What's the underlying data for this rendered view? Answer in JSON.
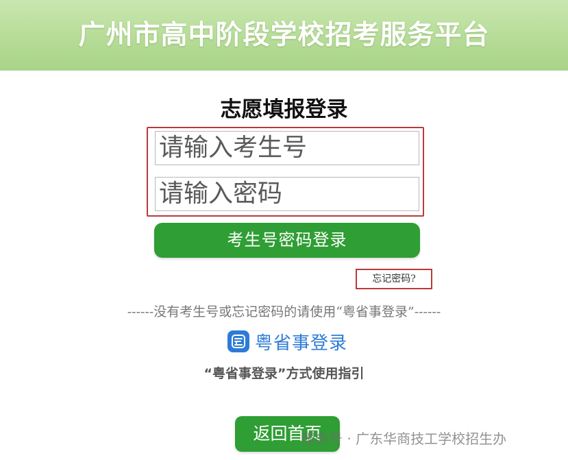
{
  "header": {
    "title": "广州市高中阶段学校招考服务平台"
  },
  "login": {
    "title": "志愿填报登录",
    "candidate_placeholder": "请输入考生号",
    "password_placeholder": "请输入密码",
    "submit_label": "考生号密码登录",
    "forgot_label": "忘记密码?"
  },
  "alternative": {
    "hint": "------没有考生号或忘记密码的请使用“粤省事登录”------",
    "yss_label": "粤省事登录",
    "guide_label": "“粤省事登录”方式使用指引"
  },
  "footer": {
    "back_label": "返回首页",
    "watermark": "服务号 · 广东华商技工学校招生办"
  },
  "icons": {
    "yss_logo": "yss-logo-icon"
  },
  "colors": {
    "header_green": "#b6dc97",
    "button_green": "#2f9e34",
    "highlight_red": "#b93a3a",
    "yss_blue": "#2d7bd6"
  }
}
